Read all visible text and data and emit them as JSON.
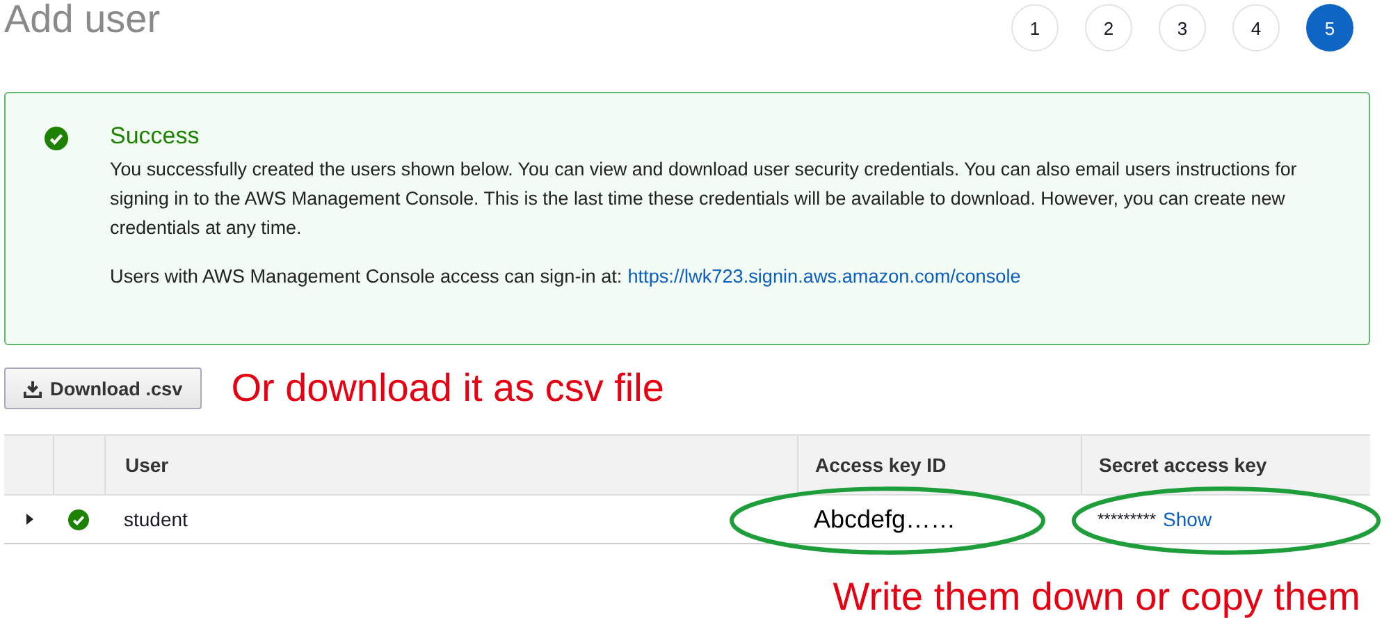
{
  "page": {
    "title": "Add user"
  },
  "steps": [
    {
      "label": "1",
      "selected": false
    },
    {
      "label": "2",
      "selected": false
    },
    {
      "label": "3",
      "selected": false
    },
    {
      "label": "4",
      "selected": false
    },
    {
      "label": "5",
      "selected": true
    }
  ],
  "alert": {
    "kind": "success",
    "title": "Success",
    "message": "You successfully created the users shown below. You can view and download user security credentials. You can also email users instructions for signing in to the AWS Management Console. This is the last time these credentials will be available to download. However, you can create new credentials at any time.",
    "signin_text": "Users with AWS Management Console access can sign-in at:",
    "signin_link": "https://lwk723.signin.aws.amazon.com/console"
  },
  "download_button": {
    "label": "Download .csv"
  },
  "annotations": [
    {
      "text": "Or download it as csv file"
    },
    {
      "text": "Write them down or copy them"
    }
  ],
  "table": {
    "columns": [
      "User",
      "Access key ID",
      "Secret access key"
    ],
    "rows": [
      {
        "expanded": false,
        "succeeded": true,
        "user": "student",
        "access_key_id": "Abcdefg……",
        "secret_mask": "*********",
        "secret_action": "Show"
      }
    ]
  }
}
